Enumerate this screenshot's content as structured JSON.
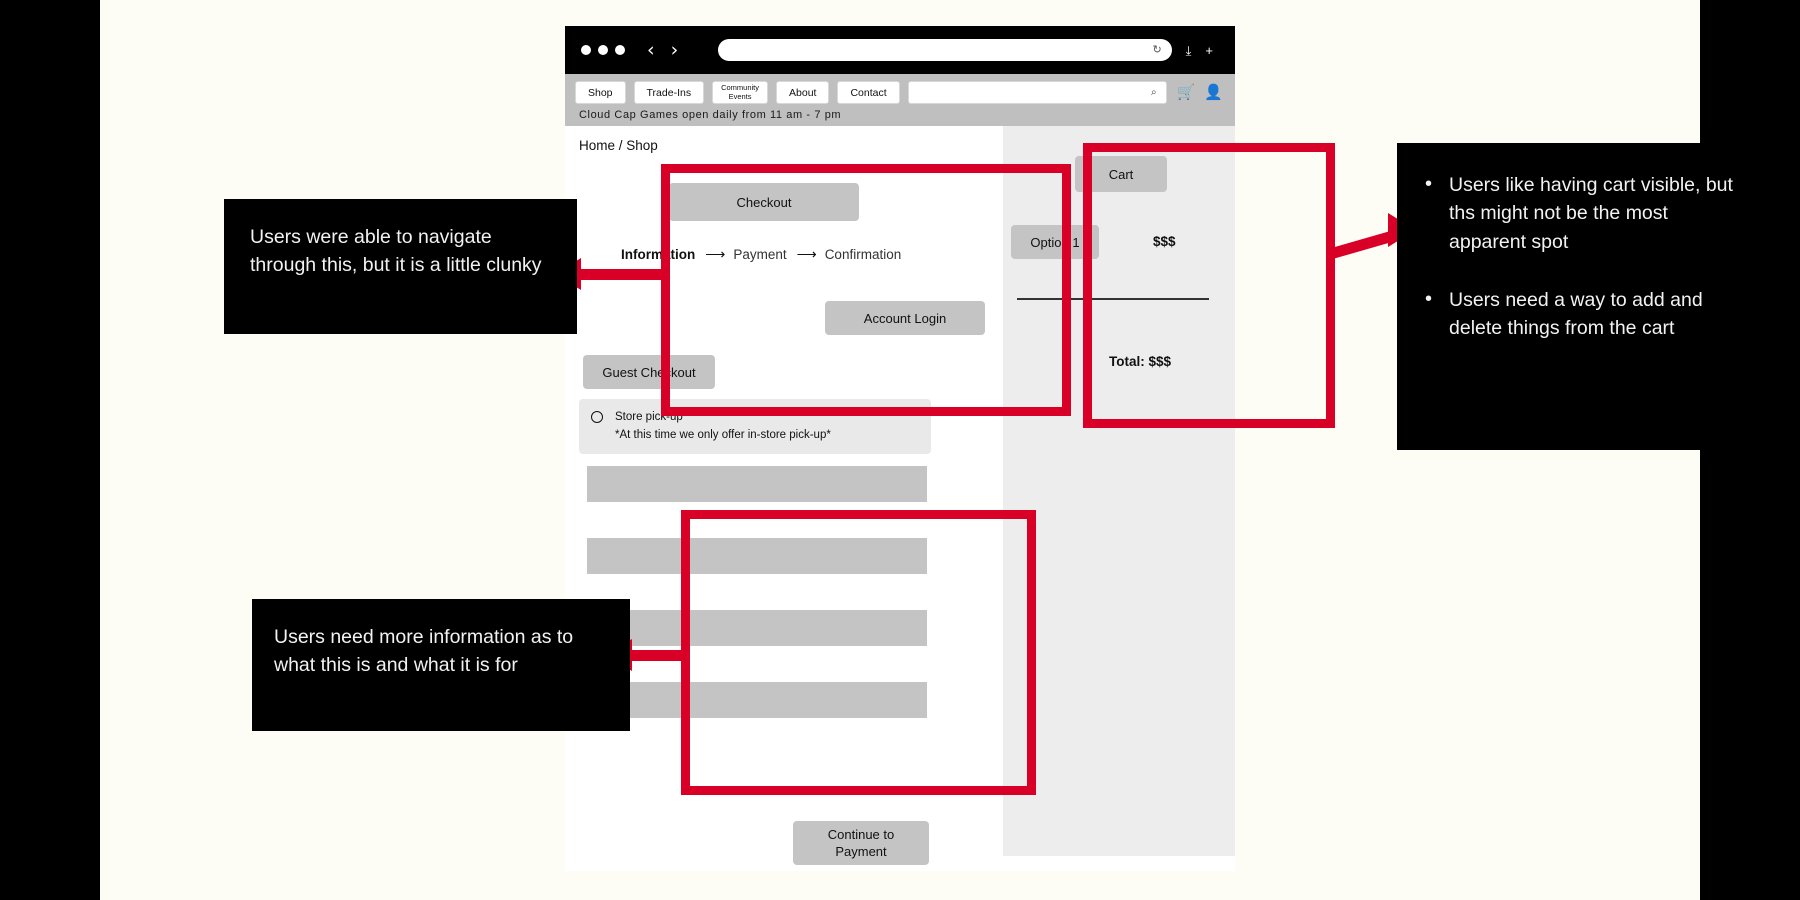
{
  "browser": {
    "window_dots": 3,
    "back_label": "‹",
    "forward_label": "›",
    "url_value": "",
    "reload_icon": "↻",
    "share_icon": "⤓",
    "newtab_icon": "+"
  },
  "site_nav": {
    "buttons": [
      {
        "label": "Shop"
      },
      {
        "label": "Trade-Ins"
      },
      {
        "label_line1": "Community",
        "label_line2": "Events"
      },
      {
        "label": "About"
      },
      {
        "label": "Contact"
      }
    ],
    "search_placeholder": "",
    "search_icon": "⌕",
    "cart_icon": "🛒",
    "account_icon": "👤",
    "store_hours": "Cloud Cap Games open daily from 11 am - 7 pm"
  },
  "page": {
    "breadcrumb": "Home / Shop",
    "checkout_button": "Checkout",
    "steps": {
      "current": "Information",
      "arrow": "⟶",
      "second": "Payment",
      "third": "Confirmation"
    },
    "account_login_button": "Account Login",
    "guest_checkout_button": "Guest Checkout",
    "pickup": {
      "option_label": "Store pick-up",
      "note": "*At this time we only offer in-store pick-up*"
    },
    "form_bars": 4,
    "continue_button_line1": "Continue to",
    "continue_button_line2": "Payment"
  },
  "cart": {
    "title_button": "Cart",
    "option_button": "Option 1",
    "item_price": "$$$",
    "total_label": "Total: $$$"
  },
  "annotations": {
    "left_top": "Users were able to navigate through this, but it is a little clunky",
    "left_bottom": "Users need more information as to what this is and what it is for",
    "right_bullets": [
      "Users like having cart visible, but ths might not be the most apparent spot",
      "Users need a way to add and delete things from the cart"
    ]
  },
  "colors": {
    "canvas_background": "#FDFDF5",
    "letterbox": "#000000",
    "highlight_red": "#D80027",
    "button_gray": "#C4C4C4",
    "nav_gray": "#BFBFBF",
    "sidebar_gray": "#EDEDED",
    "note_background": "#000000"
  }
}
